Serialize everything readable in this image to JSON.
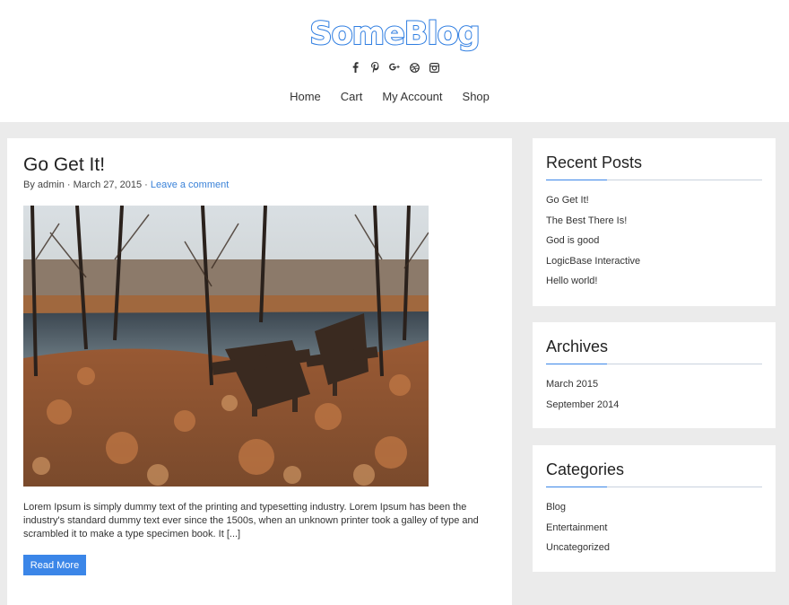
{
  "site": {
    "logo": "SomeBlog",
    "social_icons": [
      "facebook-icon",
      "pinterest-icon",
      "google-plus-icon",
      "dribbble-icon",
      "instagram-icon"
    ],
    "nav": [
      "Home",
      "Cart",
      "My Account",
      "Shop"
    ],
    "accent_color": "#3b86e8"
  },
  "post": {
    "title": "Go Get It!",
    "meta_prefix": "By admin · March 27, 2015 · ",
    "comment_link": "Leave a comment",
    "excerpt": "Lorem Ipsum is simply dummy text of the printing and typesetting industry. Lorem Ipsum has been the industry's standard dummy text ever since the 1500s, when an unknown printer took a galley of type and scrambled it to make a type specimen book. It [...]",
    "read_more": "Read More"
  },
  "sidebar": {
    "recent_posts": {
      "title": "Recent Posts",
      "items": [
        "Go Get It!",
        "The Best There Is!",
        "God is good",
        "LogicBase Interactive",
        "Hello world!"
      ]
    },
    "archives": {
      "title": "Archives",
      "items": [
        "March 2015",
        "September 2014"
      ]
    },
    "categories": {
      "title": "Categories",
      "items": [
        "Blog",
        "Entertainment",
        "Uncategorized"
      ]
    }
  }
}
